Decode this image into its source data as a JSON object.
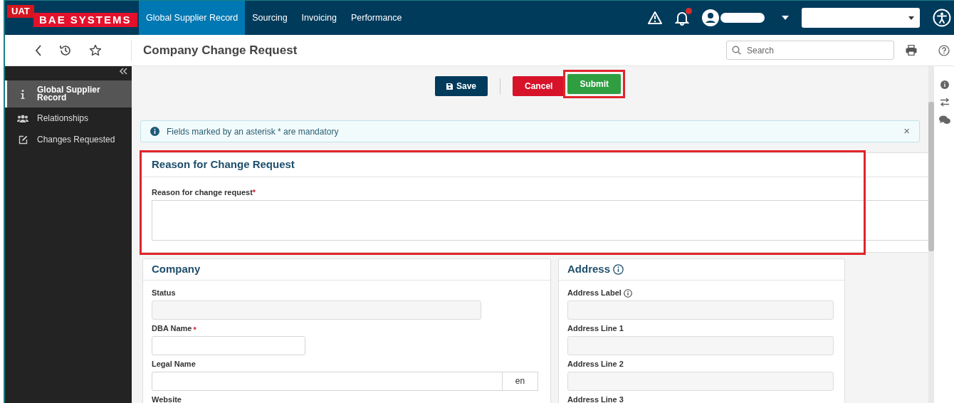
{
  "top_nav": {
    "env_badge": "UAT",
    "logo": "BAE SYSTEMS",
    "tabs": [
      {
        "label": "Global Supplier Record",
        "selected": true
      },
      {
        "label": "Sourcing",
        "selected": false
      },
      {
        "label": "Invoicing",
        "selected": false
      },
      {
        "label": "Performance",
        "selected": false
      }
    ],
    "notifications_unread": true
  },
  "toolbar": {
    "title": "Company Change Request",
    "search": {
      "placeholder": "Search"
    }
  },
  "sidebar": {
    "items": [
      {
        "label": "Global Supplier Record",
        "selected": true
      },
      {
        "label": "Relationships",
        "selected": false
      },
      {
        "label": "Changes Requested",
        "selected": false
      }
    ]
  },
  "actions": [
    {
      "label": "Save",
      "kind": "save",
      "highlighted": false
    },
    {
      "label": "Cancel",
      "kind": "cancel",
      "highlighted": false
    },
    {
      "label": "Submit",
      "kind": "submit",
      "highlighted": true
    }
  ],
  "notice": {
    "text": "Fields marked by an asterisk * are mandatory",
    "close": "×"
  },
  "reason_section": {
    "title": "Reason for Change Request",
    "highlighted": true,
    "field": {
      "label": "Reason for change request",
      "required_mark": "*"
    }
  },
  "company_section": {
    "title": "Company",
    "fields": [
      {
        "label": "Status",
        "kind": "disabled"
      },
      {
        "label": "DBA Name",
        "kind": "short",
        "required_mark": "*"
      },
      {
        "label": "Legal Name",
        "kind": "translated",
        "language": "en"
      },
      {
        "label": "Website",
        "kind": "cut"
      }
    ]
  },
  "address_section": {
    "title": "Address",
    "info": true,
    "fields": [
      {
        "label": "Address Label",
        "kind": "disabled",
        "info": true
      },
      {
        "label": "Address Line 1",
        "kind": "disabled"
      },
      {
        "label": "Address Line 2",
        "kind": "disabled"
      },
      {
        "label": "Address Line 3",
        "kind": "cut"
      }
    ]
  }
}
